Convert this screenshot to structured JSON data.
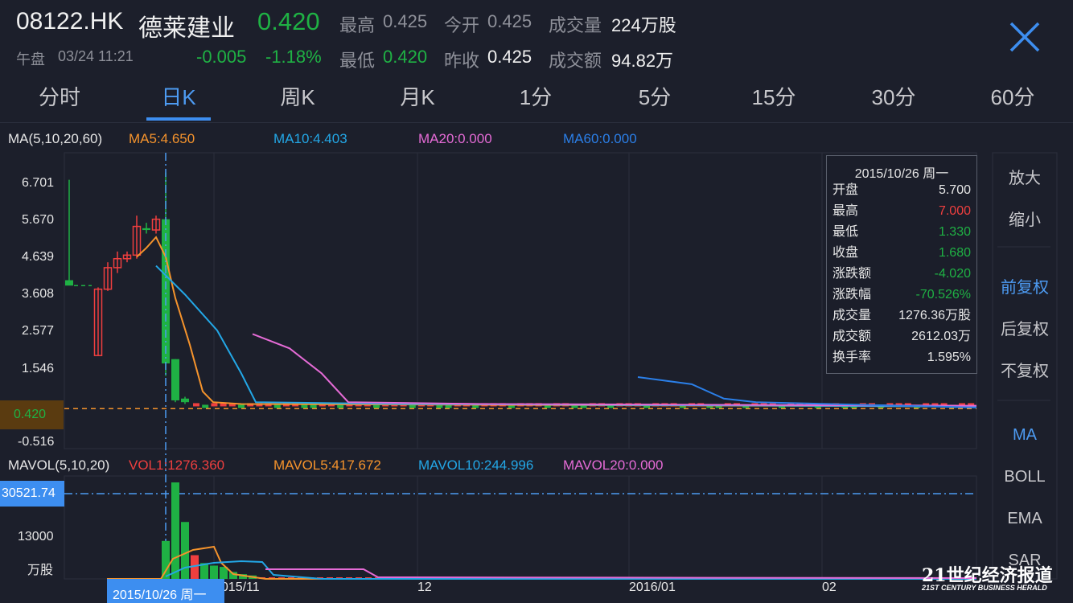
{
  "header": {
    "code": "08122.HK",
    "name": "德莱建业",
    "price": "0.420",
    "change": "-0.005",
    "change_pct": "-1.18%",
    "session": "午盘",
    "datetime": "03/24 11:21",
    "high_label": "最高",
    "high_value": "0.425",
    "open_label": "今开",
    "open_value": "0.425",
    "volume_label": "成交量",
    "volume_value": "224万股",
    "low_label": "最低",
    "low_value": "0.420",
    "prev_close_label": "昨收",
    "prev_close_value": "0.425",
    "amount_label": "成交额",
    "amount_value": "94.82万",
    "close_icon": "close-x-icon"
  },
  "tabs": [
    {
      "label": "分时",
      "active": false
    },
    {
      "label": "日K",
      "active": true
    },
    {
      "label": "周K",
      "active": false
    },
    {
      "label": "月K",
      "active": false
    },
    {
      "label": "1分",
      "active": false
    },
    {
      "label": "5分",
      "active": false
    },
    {
      "label": "15分",
      "active": false
    },
    {
      "label": "30分",
      "active": false
    },
    {
      "label": "60分",
      "active": false
    }
  ],
  "ma_legend": {
    "title": "MA(5,10,20,60)",
    "ma5": "MA5:4.650",
    "ma10": "MA10:4.403",
    "ma20": "MA20:0.000",
    "ma60": "MA60:0.000"
  },
  "vol_legend": {
    "title": "MAVOL(5,10,20)",
    "vol": "VOL1:1276.360",
    "mavol5": "MAVOL5:417.672",
    "mavol10": "MAVOL10:244.996",
    "mavol20": "MAVOL20:0.000"
  },
  "price_axis": [
    "6.701",
    "5.670",
    "4.639",
    "3.608",
    "2.577",
    "1.546",
    "-0.516"
  ],
  "current_price_tag": "0.420",
  "volume_axis": {
    "max_tag": "30521.74",
    "mid": "13000",
    "unit": "万股"
  },
  "x_axis": [
    "2015/11",
    "12",
    "2016/01",
    "02"
  ],
  "crosshair_date": "2015/10/26 周一",
  "info_box": {
    "title": "2015/10/26 周一",
    "rows": [
      {
        "k": "开盘",
        "v": "5.700",
        "color": "#e6e6e6"
      },
      {
        "k": "最高",
        "v": "7.000",
        "color": "#ef3f3f"
      },
      {
        "k": "最低",
        "v": "1.330",
        "color": "#1fb144"
      },
      {
        "k": "收盘",
        "v": "1.680",
        "color": "#1fb144"
      },
      {
        "k": "涨跌额",
        "v": "-4.020",
        "color": "#1fb144"
      },
      {
        "k": "涨跌幅",
        "v": "-70.526%",
        "color": "#1fb144"
      },
      {
        "k": "成交量",
        "v": "1276.36万股",
        "color": "#e6e6e6"
      },
      {
        "k": "成交额",
        "v": "2612.03万",
        "color": "#e6e6e6"
      },
      {
        "k": "换手率",
        "v": "1.595%",
        "color": "#e6e6e6"
      }
    ]
  },
  "side_buttons": [
    {
      "label": "放大",
      "active": false
    },
    {
      "label": "缩小",
      "active": false
    },
    {
      "label": "前复权",
      "active": true
    },
    {
      "label": "后复权",
      "active": false
    },
    {
      "label": "不复权",
      "active": false
    },
    {
      "label": "MA",
      "active": true
    },
    {
      "label": "BOLL",
      "active": false
    },
    {
      "label": "EMA",
      "active": false
    },
    {
      "label": "SAR",
      "active": false
    }
  ],
  "watermark": {
    "main": "21世纪经济报道",
    "sub": "21ST CENTURY BUSINESS HERALD"
  },
  "colors": {
    "up": "#ef3f3f",
    "down": "#1fb144",
    "accent": "#4d9bf2",
    "ma5": "#f5932c",
    "ma10": "#23a7e6",
    "ma20": "#e56bd6",
    "ma60": "#2b7fe8"
  },
  "chart_data": {
    "type": "candlestick",
    "price_range": [
      -0.516,
      6.701
    ],
    "candles": [
      {
        "o": 4.0,
        "h": 6.8,
        "l": 3.9,
        "c": 3.85,
        "dir": "down"
      },
      {
        "o": 1.9,
        "h": 3.8,
        "l": 1.9,
        "c": 3.75,
        "dir": "up"
      },
      {
        "o": 3.75,
        "h": 4.5,
        "l": 3.7,
        "c": 4.35,
        "dir": "up"
      },
      {
        "o": 4.35,
        "h": 4.8,
        "l": 4.2,
        "c": 4.6,
        "dir": "up"
      },
      {
        "o": 4.6,
        "h": 4.8,
        "l": 4.5,
        "c": 4.7,
        "dir": "up"
      },
      {
        "o": 4.7,
        "h": 5.8,
        "l": 4.6,
        "c": 5.5,
        "dir": "up"
      },
      {
        "o": 5.4,
        "h": 5.6,
        "l": 5.3,
        "c": 5.45,
        "dir": "down"
      },
      {
        "o": 5.4,
        "h": 5.8,
        "l": 5.3,
        "c": 5.7,
        "dir": "up"
      },
      {
        "o": 5.7,
        "h": 7.0,
        "l": 1.33,
        "c": 1.68,
        "dir": "down"
      },
      {
        "o": 1.8,
        "h": 1.8,
        "l": 0.6,
        "c": 0.65,
        "dir": "down"
      },
      {
        "o": 0.7,
        "h": 0.75,
        "l": 0.55,
        "c": 0.6,
        "dir": "down"
      }
    ],
    "ma5": [
      null,
      null,
      null,
      null,
      4.2,
      4.55,
      4.9,
      5.2,
      4.65,
      3.5,
      2.2,
      1.2,
      0.6,
      0.5
    ],
    "ma10": [
      4.403,
      4.0,
      3.5,
      2.8,
      2.0,
      1.0,
      0.5
    ],
    "ma20": [
      2.5,
      1.8,
      0.6
    ],
    "ma60": [
      1.3,
      1.0,
      0.6
    ],
    "volume_max": 30521.74,
    "volume_selected": 1276.36
  }
}
